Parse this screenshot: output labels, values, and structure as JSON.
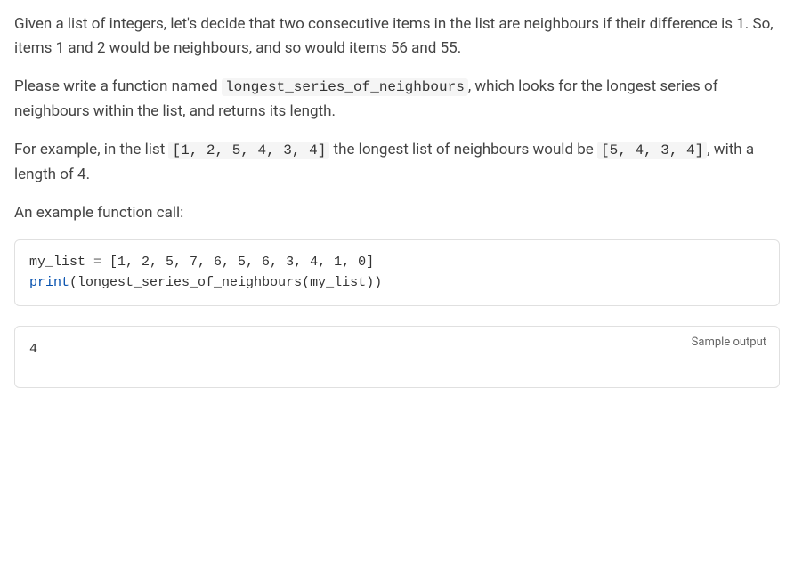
{
  "paragraphs": {
    "p1": "Given a list of integers, let's decide that two consecutive items in the list are neighbours if their difference is 1. So, items 1 and 2 would be neighbours, and so would items 56 and 55.",
    "p2a": "Please write a function named ",
    "p2_code": "longest_series_of_neighbours",
    "p2b": ", which looks for the longest series of neighbours within the list, and returns its length.",
    "p3a": "For example, in the list ",
    "p3_code1": "[1, 2, 5, 4, 3, 4]",
    "p3b": " the longest list of neighbours would be ",
    "p3_code2": "[5, 4, 3, 4]",
    "p3c": ", with a length of 4.",
    "p4": "An example function call:"
  },
  "code_example": {
    "line1_var": "my_list",
    "line1_eq": " = ",
    "line1_list": "[1, 2, 5, 7, 6, 5, 6, 3, 4, 1, 0]",
    "line2_print": "print",
    "line2_open": "(",
    "line2_fn": "longest_series_of_neighbours",
    "line2_args": "(my_list))"
  },
  "output": {
    "label": "Sample output",
    "value": "4"
  }
}
